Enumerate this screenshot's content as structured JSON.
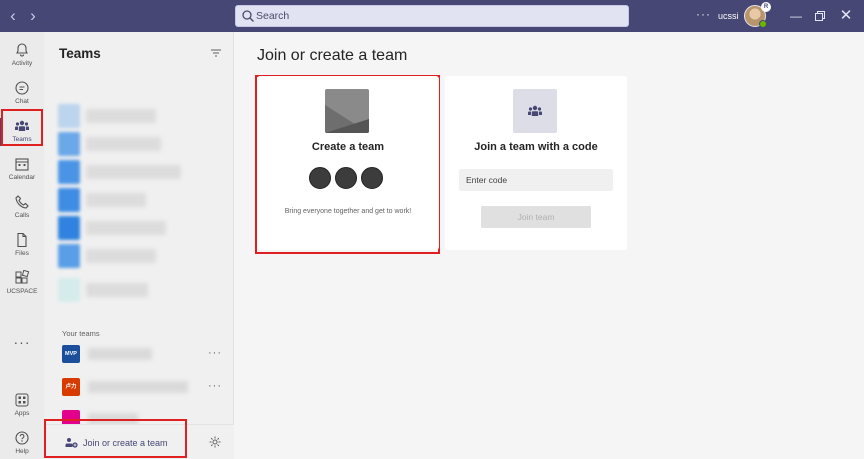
{
  "titlebar": {
    "search_placeholder": "Search",
    "more_label": "···",
    "user_name": "ucssi",
    "avatar_badge": "R"
  },
  "rail": {
    "items": [
      {
        "label": "Activity",
        "icon": "bell-icon"
      },
      {
        "label": "Chat",
        "icon": "chat-icon"
      },
      {
        "label": "Teams",
        "icon": "teams-icon",
        "active": true
      },
      {
        "label": "Calendar",
        "icon": "calendar-icon"
      },
      {
        "label": "Calls",
        "icon": "phone-icon"
      },
      {
        "label": "Files",
        "icon": "file-icon"
      },
      {
        "label": "UCSPACE",
        "icon": "apps-grid-icon"
      }
    ],
    "more": "···",
    "bottom": [
      {
        "label": "Apps",
        "icon": "apps-icon"
      },
      {
        "label": "Help",
        "icon": "help-icon"
      }
    ]
  },
  "panel": {
    "title": "Teams",
    "your_teams_label": "Your teams",
    "teams": [
      {
        "icon_text": "MVP",
        "color": "#1b4f9c"
      },
      {
        "icon_text": "卢力",
        "color": "#d83b01"
      },
      {
        "icon_text": "",
        "color": "#e3008c"
      }
    ],
    "team_more": "···",
    "join_label": "Join or create a team"
  },
  "main": {
    "title": "Join or create a team",
    "create_card": {
      "title": "Create a team",
      "subtitle": "Bring everyone together and get to work!"
    },
    "join_card": {
      "title": "Join a team with a code",
      "input_placeholder": "Enter code",
      "button_label": "Join team"
    }
  },
  "colors": {
    "brand": "#464775",
    "highlight": "#e02020"
  }
}
